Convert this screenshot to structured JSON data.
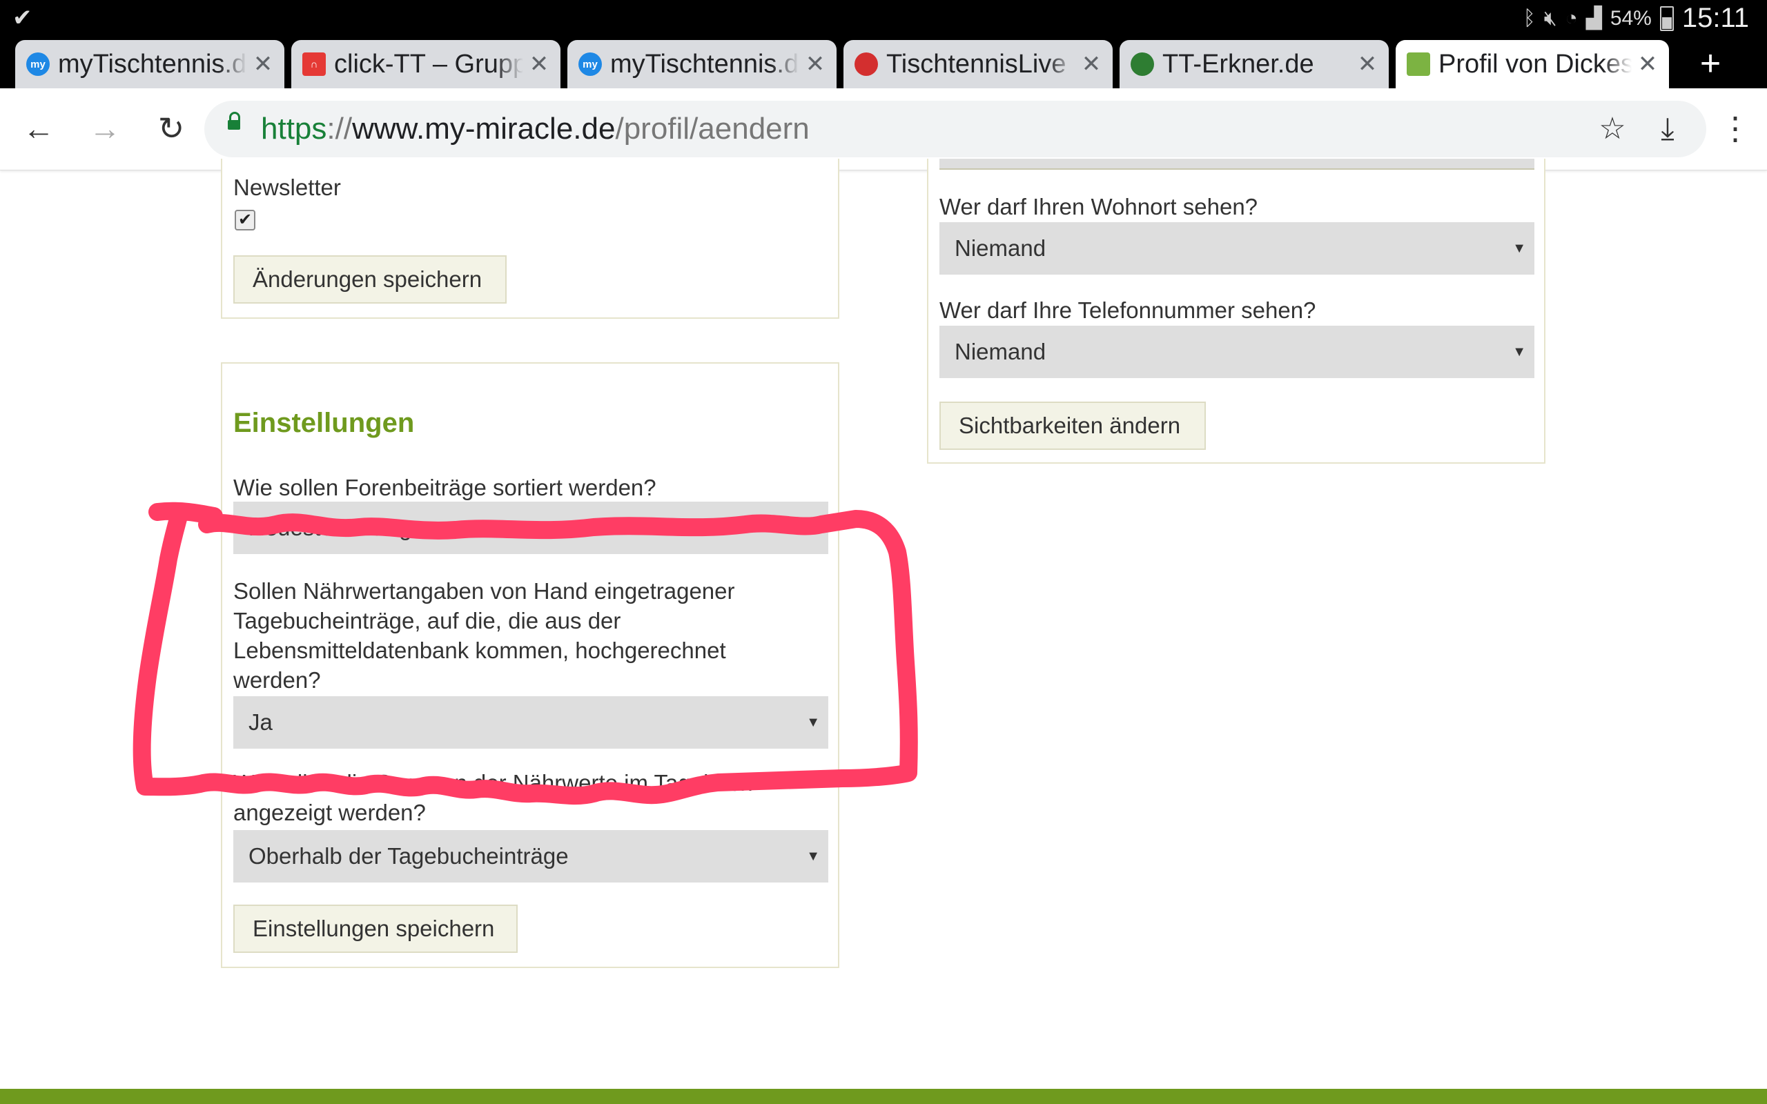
{
  "status_bar": {
    "battery": "54%",
    "time": "15:11",
    "icons": [
      "bluetooth-icon",
      "mute-icon",
      "wifi-icon",
      "signal-icon",
      "battery-icon"
    ]
  },
  "tabs": [
    {
      "title": "myTischtennis.de",
      "favicon": "mytischtennis-icon"
    },
    {
      "title": "click-TT – Gruppe",
      "favicon": "clicktt-icon"
    },
    {
      "title": "myTischtennis.de",
      "favicon": "mytischtennis-icon"
    },
    {
      "title": "TischtennisLive",
      "favicon": "paddle-icon"
    },
    {
      "title": "TT-Erkner.de",
      "favicon": "club-icon"
    },
    {
      "title": "Profil von Dickes",
      "favicon": "mymiracle-icon",
      "active": true
    }
  ],
  "toolbar": {
    "url_scheme": "https",
    "url_sep": "://",
    "url_host": "www.my-miracle.de",
    "url_path": "/profil/aendern"
  },
  "left_top_panel": {
    "newsletter_label": "Newsletter",
    "newsletter_checked": true,
    "save_button": "Änderungen speichern"
  },
  "settings_panel": {
    "heading": "Einstellungen",
    "q_sort": "Wie sollen Forenbeiträge sortiert werden?",
    "q_sort_value": "Neueste Beiträge zuerst",
    "q_nutrition_lines": [
      "Sollen Nährwertangaben von Hand eingetragener",
      "Tagebucheinträge, auf die, die aus der",
      "Lebensmitteldatenbank kommen, hochgerechnet",
      "werden?"
    ],
    "q_nutrition_value": "Ja",
    "q_summary_partial": "Wo sollen die Summen der Nährwerte im Tagebuch",
    "q_summary_line2": "angezeigt werden?",
    "q_summary_value": "Oberhalb der Tagebucheinträge",
    "save_button": "Einstellungen speichern"
  },
  "visibility_panel": {
    "q_residence": "Wer darf Ihren Wohnort sehen?",
    "q_residence_value": "Niemand",
    "q_phone": "Wer darf Ihre Telefonnummer sehen?",
    "q_phone_value": "Niemand",
    "change_button": "Sichtbarkeiten ändern"
  },
  "annotation": {
    "color": "#ff3d64"
  },
  "colors": {
    "accent_green": "#6f9a1e"
  }
}
